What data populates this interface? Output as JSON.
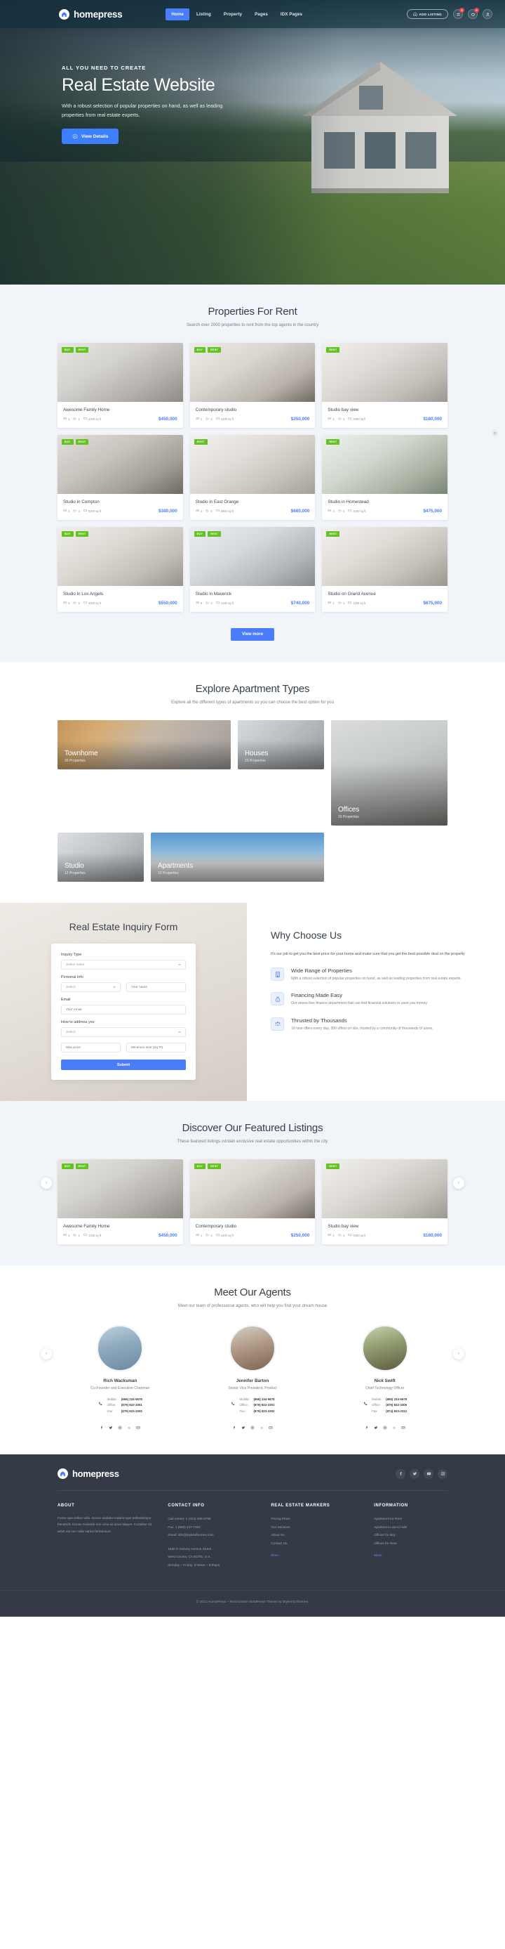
{
  "header": {
    "brand": "homepress",
    "nav": [
      {
        "label": "Home",
        "active": true
      },
      {
        "label": "Listing",
        "active": false
      },
      {
        "label": "Property",
        "active": false
      },
      {
        "label": "Pages",
        "active": false
      },
      {
        "label": "IDX Pages",
        "active": false
      }
    ],
    "add_listing": "ADD LISTING",
    "compare_badge": "0",
    "favorites_badge": "0"
  },
  "hero": {
    "eyebrow": "ALL YOU NEED TO CREATE",
    "title": "Real Estate Website",
    "desc": "With a robust selection of popular properties on hand, as well as leading properties from real estate experts.",
    "cta": "View Details"
  },
  "rent": {
    "title": "Properties For Rent",
    "subtitle": "Search over 2000 properties to rent from the top agents in the country",
    "view_more": "View more",
    "cards": [
      {
        "name": "Awesome Family Home",
        "beds": "1",
        "baths": "1",
        "area": "1200 sq ft",
        "price": "$450,000",
        "tags": [
          "BUY",
          "RENT"
        ]
      },
      {
        "name": "Contemporary studio",
        "beds": "1",
        "baths": "1",
        "area": "1300 sq ft",
        "price": "$250,000",
        "tags": [
          "BUY",
          "RENT"
        ]
      },
      {
        "name": "Studio bay view",
        "beds": "1",
        "baths": "1",
        "area": "4400 sq ft",
        "price": "$180,000",
        "tags": [
          "RENT"
        ]
      },
      {
        "name": "Studio in Compton",
        "beds": "4",
        "baths": "3",
        "area": "5200 sq ft",
        "price": "$380,000",
        "tags": [
          "BUY",
          "RENT"
        ]
      },
      {
        "name": "Studio in East Orange",
        "beds": "4",
        "baths": "5",
        "area": "5980 sq ft",
        "price": "$680,000",
        "tags": [
          "RENT"
        ]
      },
      {
        "name": "Studio in Homestead",
        "beds": "4",
        "baths": "4",
        "area": "4150 sq ft",
        "price": "$475,000",
        "tags": [
          "RENT"
        ]
      },
      {
        "name": "Studio in Los Angels",
        "beds": "5",
        "baths": "5",
        "area": "6200 sq ft",
        "price": "$550,000",
        "tags": [
          "BUY",
          "RENT"
        ]
      },
      {
        "name": "Studio in Maverick",
        "beds": "5",
        "baths": "3",
        "area": "4180 sq ft",
        "price": "$740,000",
        "tags": [
          "BUY",
          "RENT"
        ]
      },
      {
        "name": "Studio on Grand Avenue",
        "beds": "1",
        "baths": "1",
        "area": "1150 sq ft",
        "price": "$675,000",
        "tags": [
          "RENT"
        ]
      }
    ]
  },
  "types": {
    "title": "Explore Apartment Types",
    "subtitle": "Explore all the different types of apartments so you can choose the best option for you",
    "tiles": [
      {
        "name": "Townhome",
        "count": "20 Properties"
      },
      {
        "name": "Houses",
        "count": "20 Properties"
      },
      {
        "name": "Offices",
        "count": "20 Properties"
      },
      {
        "name": "Studio",
        "count": "12 Properties"
      },
      {
        "name": "Apartments",
        "count": "19 Properties"
      }
    ]
  },
  "inquiry": {
    "title": "Real Estate Inquiry Form",
    "label_type": "Inquiry Type",
    "value_type": "Select value",
    "label_personal": "Personal Info",
    "value_salutation": "Select",
    "placeholder_name": "Your name",
    "label_email": "Email",
    "placeholder_email": "Your email",
    "label_address": "How to address you",
    "value_address": "Select",
    "placeholder_maxprice": "Max price",
    "placeholder_minsize": "Minimum size (Sq Ft)",
    "submit": "Submit"
  },
  "why": {
    "title": "Why Choose Us",
    "lead": "It's our job to get you the best price for your home and make sure that you get the best possible deal on the property",
    "features": [
      {
        "icon": "building-icon",
        "title": "Wide Range of Properties",
        "text": "With a robust selection of popular properties on hand, as well as leading properties from real estate experts."
      },
      {
        "icon": "money-bag-icon",
        "title": "Financing Made Easy",
        "text": "Our stress-free finance department that can find financial solutions to save you money."
      },
      {
        "icon": "people-icon",
        "title": "Thrusted by Thousands",
        "text": "10 new offers every day. 350 offers on site, trusted by a community of thousands of users."
      }
    ]
  },
  "featured": {
    "title": "Discover Our Featured Listings",
    "subtitle": "These featured listings contain exclusive real estate opportunities within the city",
    "cards": [
      {
        "name": "Awesome Family Home",
        "beds": "1",
        "baths": "1",
        "area": "1200 sq ft",
        "price": "$450,000",
        "tags": [
          "BUY",
          "RENT"
        ]
      },
      {
        "name": "Contemporary studio",
        "beds": "1",
        "baths": "1",
        "area": "1300 sq ft",
        "price": "$250,000",
        "tags": [
          "BUY",
          "RENT"
        ]
      },
      {
        "name": "Studio bay view",
        "beds": "1",
        "baths": "1",
        "area": "4400 sq ft",
        "price": "$180,000",
        "tags": [
          "RENT"
        ]
      }
    ]
  },
  "agents": {
    "title": "Meet Our Agents",
    "subtitle": "Meet our team of professional agents, who will help you find your dream house",
    "label_mobile": "Mobile:",
    "label_office": "Office:",
    "label_fax": "Fax:",
    "list": [
      {
        "name": "Rich Wacksman",
        "role": "Co-Founder and Executive Chairman",
        "mobile": "(866) 234-5678",
        "office": "(879) 822-3301",
        "fax": "(879) 823-3302"
      },
      {
        "name": "Jennifer Barton",
        "role": "Senior Vice President, Product",
        "mobile": "(866) 234-5678",
        "office": "(879) 822-3301",
        "fax": "(879) 823-3302"
      },
      {
        "name": "Nick Swift",
        "role": "Chief Technology Officer",
        "mobile": "(865) 234-5679",
        "office": "(875) 822-3306",
        "fax": "(874) 823-3312"
      }
    ]
  },
  "footer": {
    "brand": "homepress",
    "about_heading": "ABOUT",
    "about_text": "Fusce quis tellus nulla. Donec sodales mauris eget pellentesque hendrerit. Donec molestie non urna sit amet aliquet. Curabitur sit amet est nec nulla varius fermentum.",
    "contact_heading": "CONTACT INFO",
    "contact_call": "Call-centre: 1 (323) 938-5798",
    "contact_fax": "Fax: 1 (888) 637-7262",
    "contact_email": "Email: info@stylelxthemes.com",
    "contact_addr1": "1840 E Garvey Avenue Street",
    "contact_addr2": "West Covina, CA 91791, U.S.",
    "contact_hours": "Monday – Friday: 9:00am – 9:00pm",
    "markers_heading": "REAL ESTATE MARKERS",
    "markers": [
      "Pricing Plans",
      "Our Services",
      "About Us",
      "Contact Us"
    ],
    "markers_more": "More ›",
    "info_heading": "INFORMATION",
    "info": [
      "Apartment for Rent",
      "Apartment Low to hide",
      "Offices for Buy",
      "Offices for Rent"
    ],
    "info_more": "More ›",
    "copyright": "© 2021 HomePress – Real Estate WordPress Theme by StylemixThemes."
  },
  "colors": {
    "accent": "#4a7dfc",
    "tag": "#64c223",
    "badge": "#f0444c",
    "footer_bg": "#343b46"
  }
}
